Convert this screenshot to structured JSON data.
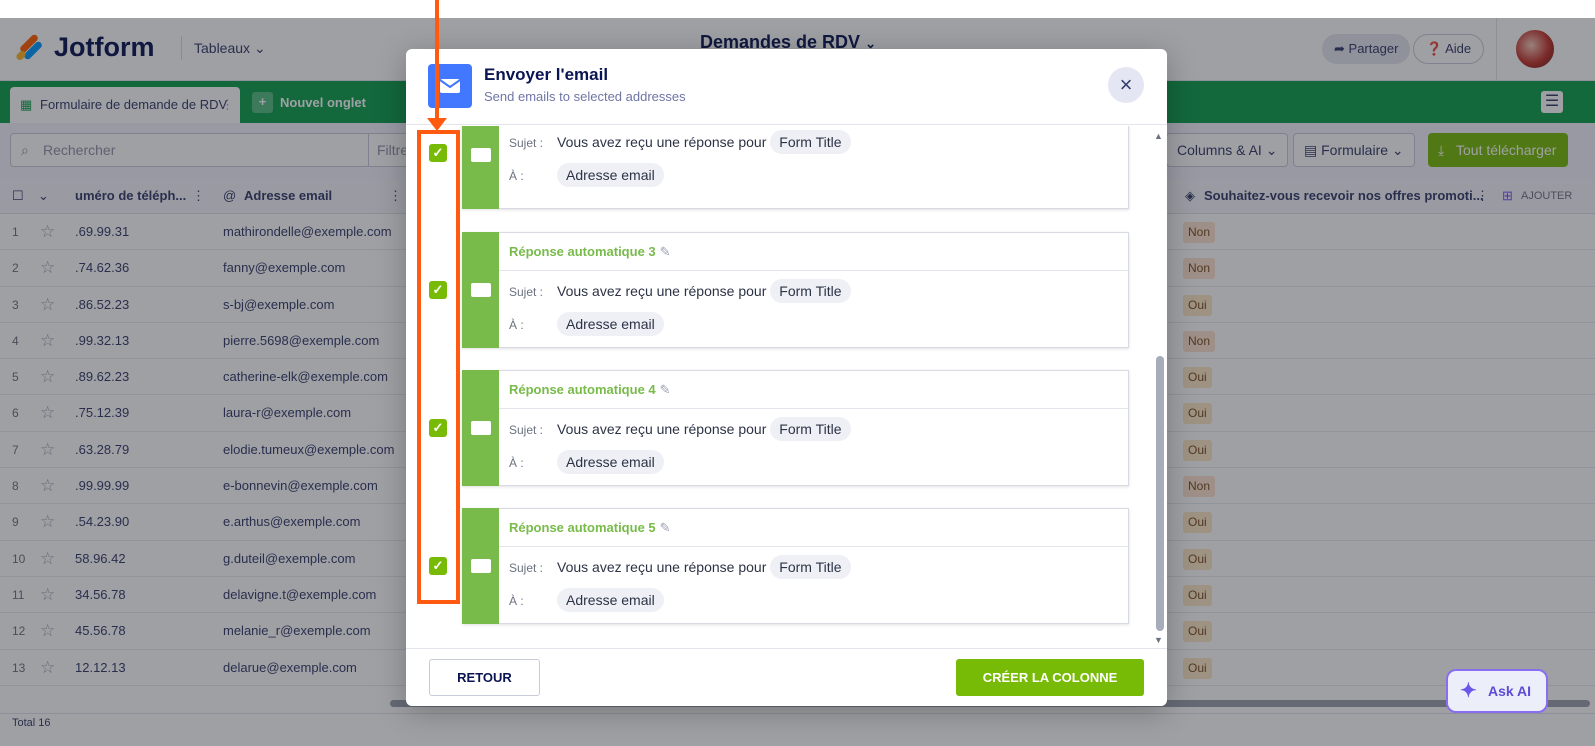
{
  "app": {
    "brand": "Jotform",
    "tables_menu": "Tableaux",
    "page_title": "Demandes de RDV",
    "share": "Partager",
    "help": "Aide"
  },
  "tabs": {
    "active": "Formulaire de demande de RDV",
    "new_tab": "Nouvel onglet"
  },
  "toolbar": {
    "search_placeholder": "Rechercher",
    "filter": "Filtre",
    "columns_ai": "Columns & AI",
    "form": "Formulaire",
    "download_all": "Tout télécharger"
  },
  "grid": {
    "col_phone": "uméro de téléph...",
    "col_email": "Adresse email",
    "col_promo": "Souhaitez-vous recevoir nos offres promoti...",
    "col_add": "AJOUTER",
    "rows": [
      {
        "n": "1",
        "phone": ".69.99.31",
        "email": "mathirondelle@exemple.com",
        "promo": "Non"
      },
      {
        "n": "2",
        "phone": ".74.62.36",
        "email": "fanny@exemple.com",
        "promo": "Non"
      },
      {
        "n": "3",
        "phone": ".86.52.23",
        "email": "s-bj@exemple.com",
        "promo": "Oui"
      },
      {
        "n": "4",
        "phone": ".99.32.13",
        "email": "pierre.5698@exemple.com",
        "promo": "Non"
      },
      {
        "n": "5",
        "phone": ".89.62.23",
        "email": "catherine-elk@exemple.com",
        "promo": "Oui"
      },
      {
        "n": "6",
        "phone": ".75.12.39",
        "email": "laura-r@exemple.com",
        "promo": "Oui"
      },
      {
        "n": "7",
        "phone": ".63.28.79",
        "email": "elodie.tumeux@exemple.com",
        "promo": "Oui"
      },
      {
        "n": "8",
        "phone": ".99.99.99",
        "email": "e-bonnevin@exemple.com",
        "promo": "Non"
      },
      {
        "n": "9",
        "phone": ".54.23.90",
        "email": "e.arthus@exemple.com",
        "promo": "Oui"
      },
      {
        "n": "10",
        "phone": "58.96.42",
        "email": "g.duteil@exemple.com",
        "promo": "Oui"
      },
      {
        "n": "11",
        "phone": "34.56.78",
        "email": "delavigne.t@exemple.com",
        "promo": "Oui"
      },
      {
        "n": "12",
        "phone": "45.56.78",
        "email": "melanie_r@exemple.com",
        "promo": "Oui"
      },
      {
        "n": "13",
        "phone": "12.12.13",
        "email": "delarue@exemple.com",
        "promo": "Oui"
      }
    ],
    "total": "Total 16"
  },
  "ask_ai": "Ask AI",
  "modal": {
    "title": "Envoyer l'email",
    "subtitle": "Send emails to selected addresses",
    "close_icon": "×",
    "subject_label": "Sujet :",
    "to_label": "À :",
    "subject_text": "Vous avez reçu une réponse pour",
    "subject_tag": "Form Title",
    "to_tag": "Adresse email",
    "cards": [
      {
        "title": ""
      },
      {
        "title": "Réponse automatique 3"
      },
      {
        "title": "Réponse automatique 4"
      },
      {
        "title": "Réponse automatique 5"
      }
    ],
    "back": "RETOUR",
    "create": "CRÉER LA COLONNE"
  },
  "colors": {
    "accent_green": "#78bb07",
    "card_green": "#78bb4a",
    "annotation": "#ff5a10",
    "modal_icon": "#4277ff"
  }
}
